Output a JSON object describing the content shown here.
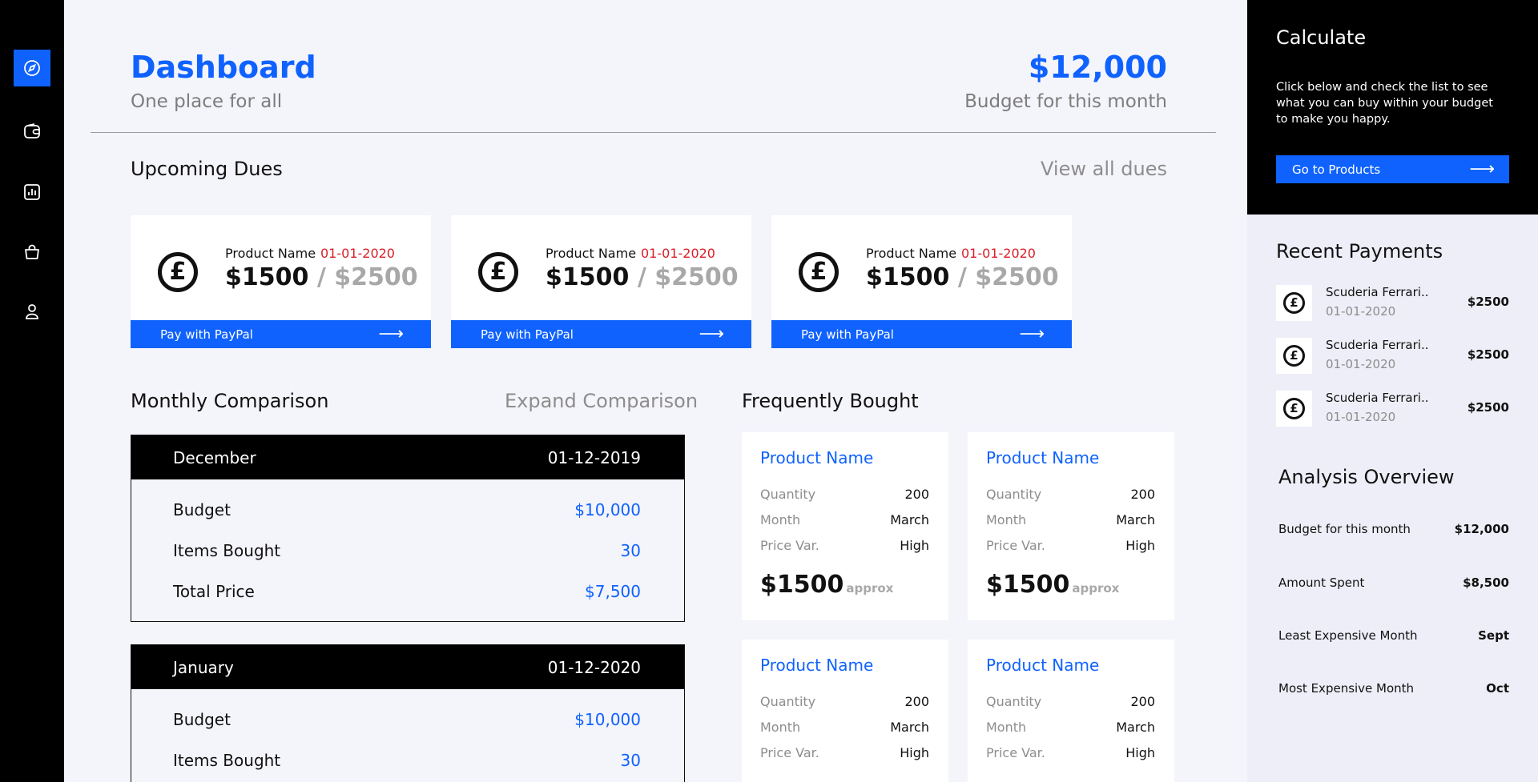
{
  "colors": {
    "accent": "#0f62fe",
    "alert": "#da1e28",
    "rail": "#000000"
  },
  "nav": [
    {
      "icon": "compass-icon",
      "active": true
    },
    {
      "icon": "wallet-icon",
      "active": false
    },
    {
      "icon": "chart-icon",
      "active": false
    },
    {
      "icon": "shopping-bag-icon",
      "active": false
    },
    {
      "icon": "user-icon",
      "active": false
    }
  ],
  "header": {
    "title": "Dashboard",
    "subtitle": "One place for all",
    "budget_amount": "$12,000",
    "budget_label": "Budget for this month"
  },
  "dues": {
    "title": "Upcoming Dues",
    "view_all": "View all dues",
    "currency_icon": "£",
    "cards": [
      {
        "name": "Product Name",
        "date": "01-01-2020",
        "paid": "$1500",
        "sep": "/",
        "total": "$2500",
        "cta": "Pay with PayPal"
      },
      {
        "name": "Product Name",
        "date": "01-01-2020",
        "paid": "$1500",
        "sep": "/",
        "total": "$2500",
        "cta": "Pay with PayPal"
      },
      {
        "name": "Product Name",
        "date": "01-01-2020",
        "paid": "$1500",
        "sep": "/",
        "total": "$2500",
        "cta": "Pay with PayPal"
      }
    ]
  },
  "comparison": {
    "title": "Monthly Comparison",
    "expand": "Expand Comparison",
    "months": [
      {
        "month": "December",
        "date": "01-12-2019",
        "rows": [
          {
            "label": "Budget",
            "value": "$10,000"
          },
          {
            "label": "Items Bought",
            "value": "30"
          },
          {
            "label": "Total Price",
            "value": "$7,500"
          }
        ]
      },
      {
        "month": "January",
        "date": "01-12-2020",
        "rows": [
          {
            "label": "Budget",
            "value": "$10,000"
          },
          {
            "label": "Items Bought",
            "value": "30"
          }
        ]
      }
    ]
  },
  "frequent": {
    "title": "Frequently Bought",
    "products": [
      {
        "name": "Product Name",
        "quantity_label": "Quantity",
        "quantity": "200",
        "month_label": "Month",
        "month": "March",
        "price_var_label": "Price Var.",
        "price_var": "High",
        "price": "$1500",
        "approx": "approx"
      },
      {
        "name": "Product Name",
        "quantity_label": "Quantity",
        "quantity": "200",
        "month_label": "Month",
        "month": "March",
        "price_var_label": "Price Var.",
        "price_var": "High",
        "price": "$1500",
        "approx": "approx"
      },
      {
        "name": "Product Name",
        "quantity_label": "Quantity",
        "quantity": "200",
        "month_label": "Month",
        "month": "March",
        "price_var_label": "Price Var.",
        "price_var": "High"
      },
      {
        "name": "Product Name",
        "quantity_label": "Quantity",
        "quantity": "200",
        "month_label": "Month",
        "month": "March",
        "price_var_label": "Price Var.",
        "price_var": "High"
      }
    ]
  },
  "calculate": {
    "title": "Calculate",
    "description": "Click below and check the list to see what you can buy within your budget to make you happy.",
    "cta": "Go to Products"
  },
  "recent_payments": {
    "title": "Recent Payments",
    "items": [
      {
        "name": "Scuderia Ferrari..",
        "date": "01-01-2020",
        "amount": "$2500"
      },
      {
        "name": "Scuderia Ferrari..",
        "date": "01-01-2020",
        "amount": "$2500"
      },
      {
        "name": "Scuderia Ferrari..",
        "date": "01-01-2020",
        "amount": "$2500"
      }
    ]
  },
  "analysis": {
    "title": "Analysis Overview",
    "rows": [
      {
        "label": "Budget for this month",
        "value": "$12,000"
      },
      {
        "label": "Amount Spent",
        "value": "$8,500"
      },
      {
        "label": "Least Expensive Month",
        "value": "Sept"
      },
      {
        "label": "Most Expensive Month",
        "value": "Oct"
      }
    ]
  }
}
